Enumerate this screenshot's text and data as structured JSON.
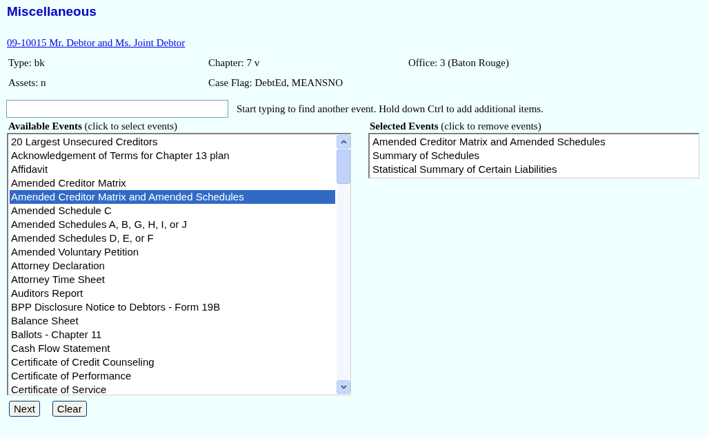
{
  "page": {
    "title": "Miscellaneous"
  },
  "case": {
    "link": "09-10015 Mr. Debtor and Ms. Joint Debtor",
    "info_rows": [
      [
        "Type: bk",
        "Chapter: 7 v",
        "Office: 3 (Baton Rouge)"
      ],
      [
        "Assets: n",
        "Case Flag: DebtEd, MEANSNO"
      ]
    ]
  },
  "search": {
    "hint": "Start typing to find another event. Hold down Ctrl to add additional items."
  },
  "available_events": {
    "heading": "**Available Events** (click to select events)",
    "items": [
      {
        "label": "20 Largest Unsecured Creditors",
        "selected": false
      },
      {
        "label": "Acknowledgement of Terms for Chapter 13 plan",
        "selected": false
      },
      {
        "label": "Affidavit",
        "selected": false
      },
      {
        "label": "Amended Creditor Matrix",
        "selected": false
      },
      {
        "label": "Amended Creditor Matrix and Amended Schedules",
        "selected": true
      },
      {
        "label": "Amended Schedule C",
        "selected": false
      },
      {
        "label": "Amended Schedules A, B, G, H, I, or J",
        "selected": false
      },
      {
        "label": "Amended Schedules D, E, or F",
        "selected": false
      },
      {
        "label": "Amended Voluntary Petition",
        "selected": false
      },
      {
        "label": "Attorney Declaration",
        "selected": false
      },
      {
        "label": "Attorney Time Sheet",
        "selected": false
      },
      {
        "label": "Auditors Report",
        "selected": false
      },
      {
        "label": "BPP Disclosure Notice to Debtors - Form 19B",
        "selected": false
      },
      {
        "label": "Balance Sheet",
        "selected": false
      },
      {
        "label": "Ballots - Chapter 11",
        "selected": false
      },
      {
        "label": "Cash Flow Statement",
        "selected": false
      },
      {
        "label": "Certificate of Credit Counseling",
        "selected": false
      },
      {
        "label": "Certificate of Performance",
        "selected": false
      },
      {
        "label": "Certificate of Service",
        "selected": false
      }
    ]
  },
  "selected_events": {
    "heading": "**Selected Events** (click to remove events)",
    "items": [
      "Amended Creditor Matrix and Amended Schedules",
      "Summary of Schedules",
      "Statistical Summary of Certain Liabilities"
    ]
  },
  "buttons": [
    "Next",
    "Clear"
  ]
}
